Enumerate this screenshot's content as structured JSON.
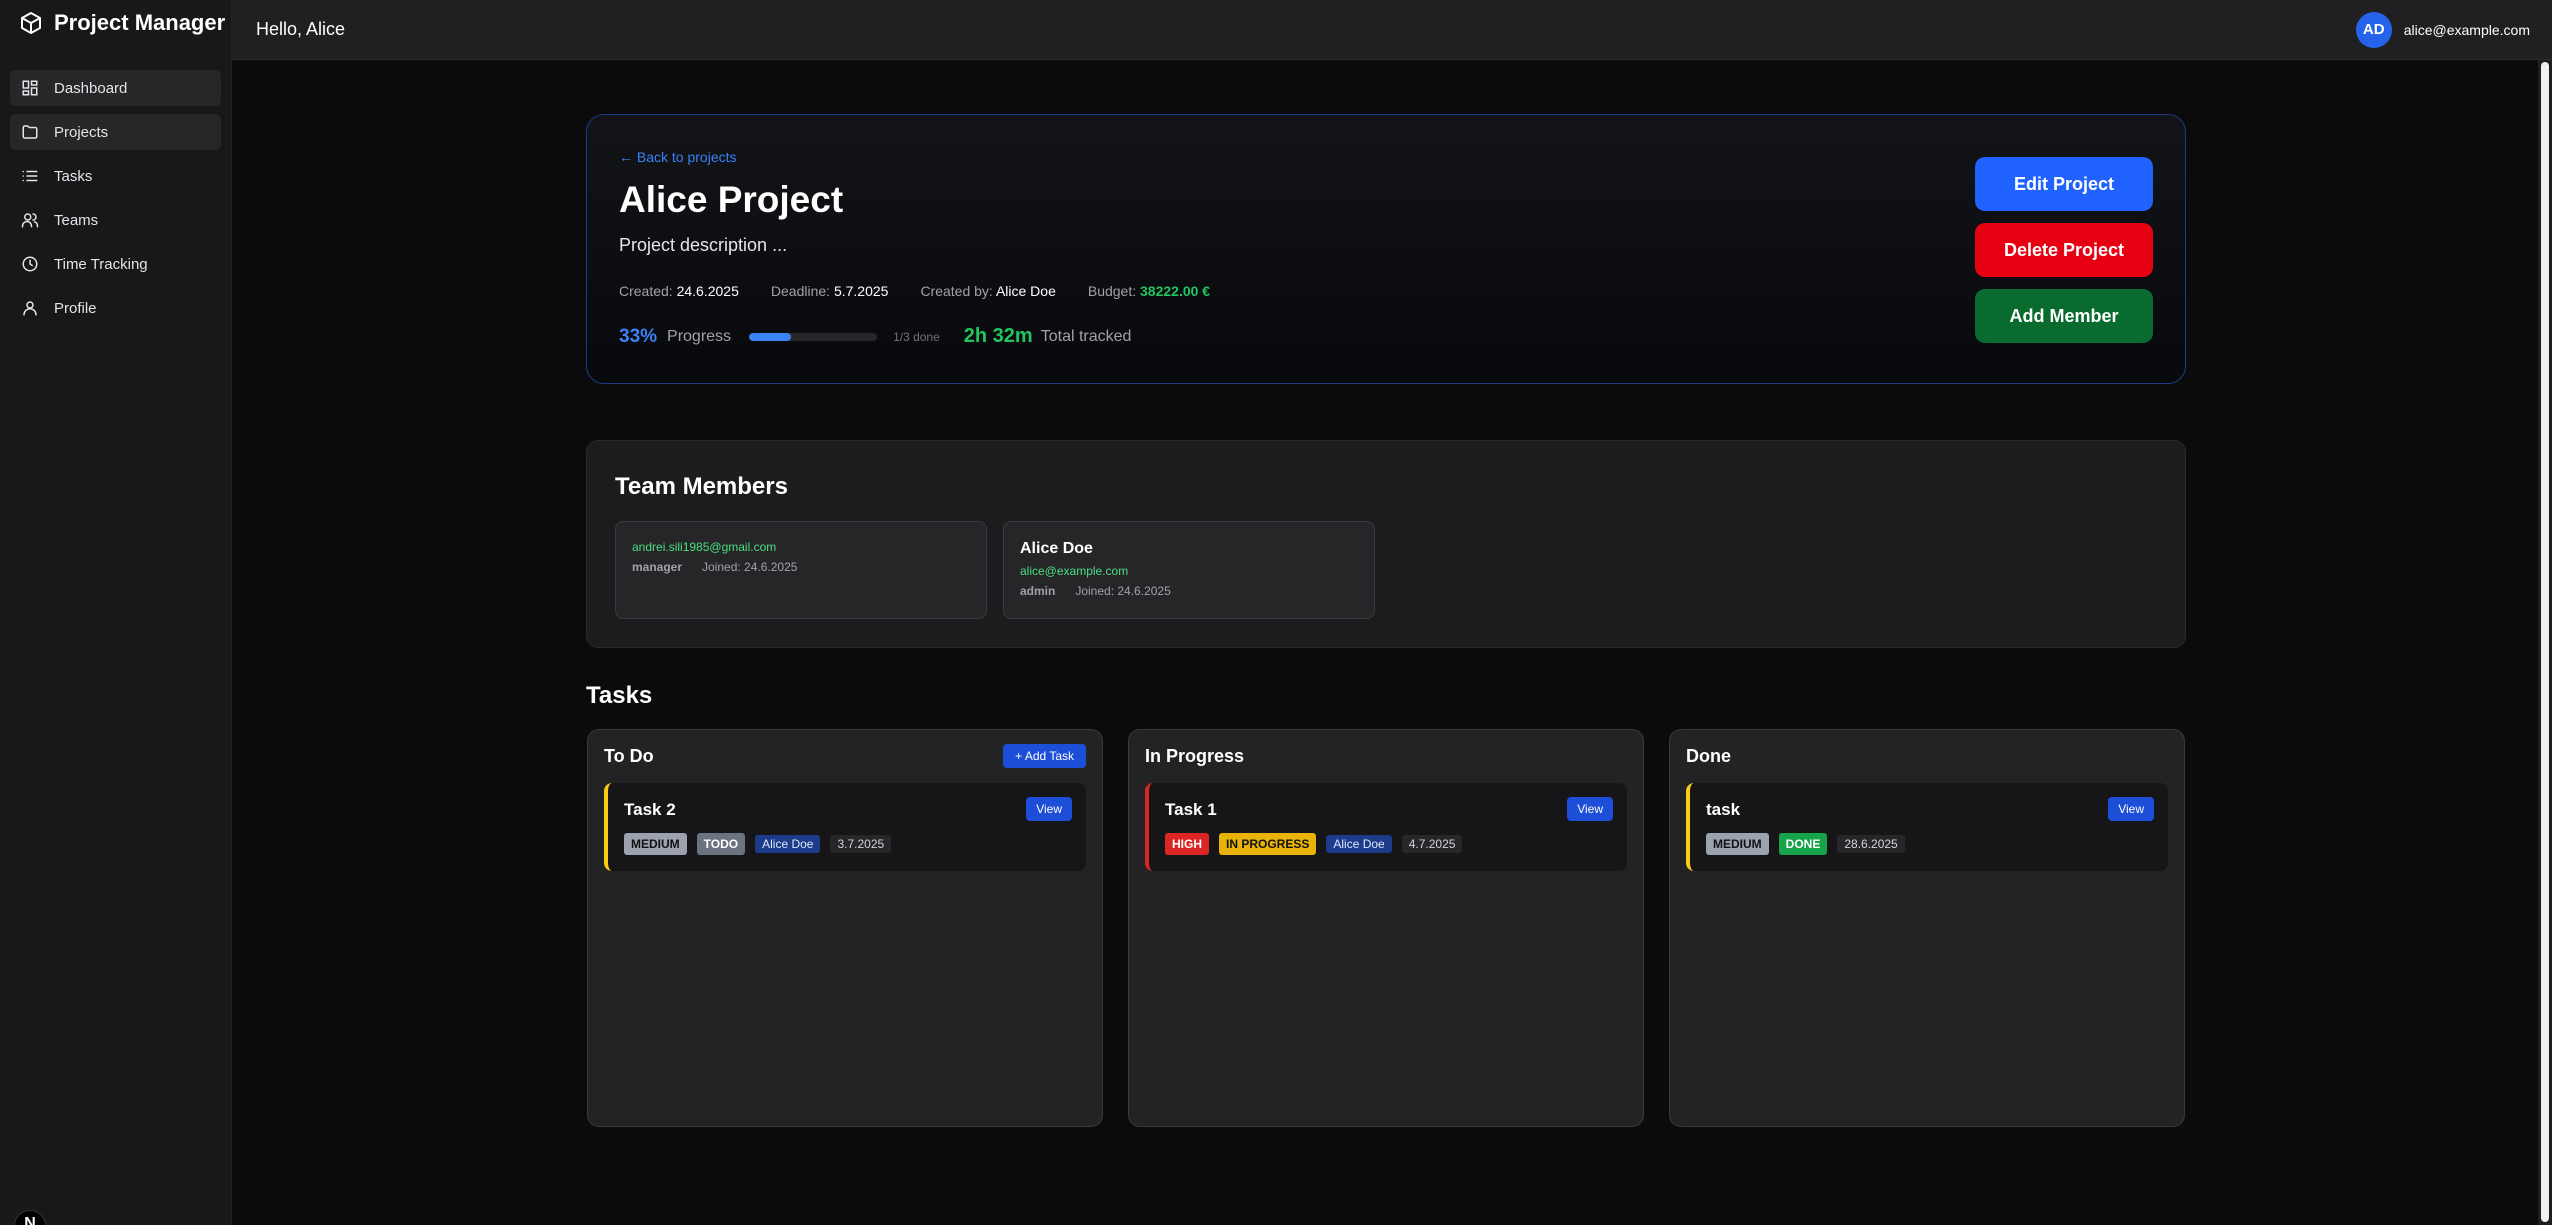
{
  "app": {
    "title": "Project Manager",
    "next_badge": "N"
  },
  "sidebar": {
    "items": [
      {
        "label": "Dashboard",
        "icon": "dashboard-icon"
      },
      {
        "label": "Projects",
        "icon": "folder-icon"
      },
      {
        "label": "Tasks",
        "icon": "list-icon"
      },
      {
        "label": "Teams",
        "icon": "users-icon"
      },
      {
        "label": "Time Tracking",
        "icon": "clock-icon"
      },
      {
        "label": "Profile",
        "icon": "user-icon"
      }
    ]
  },
  "header": {
    "greeting": "Hello, Alice",
    "avatar_initials": "AD",
    "email": "alice@example.com"
  },
  "project": {
    "back_link": "← Back to projects",
    "title": "Alice Project",
    "description": "Project description ...",
    "created_label": "Created:",
    "created": "24.6.2025",
    "deadline_label": "Deadline:",
    "deadline": "5.7.2025",
    "created_by_label": "Created by:",
    "created_by": "Alice Doe",
    "budget_label": "Budget:",
    "budget": "38222.00 €",
    "progress_pct": "33%",
    "progress_label": "Progress",
    "progress_fraction": 0.33,
    "done_count": "1/3 done",
    "tracked_time": "2h 32m",
    "tracked_label": "Total tracked",
    "buttons": {
      "edit": "Edit Project",
      "delete": "Delete Project",
      "add_member": "Add Member"
    }
  },
  "team": {
    "title": "Team Members",
    "members": [
      {
        "name": "",
        "email": "andrei.sili1985@gmail.com",
        "role": "manager",
        "joined": "Joined: 24.6.2025"
      },
      {
        "name": "Alice Doe",
        "email": "alice@example.com",
        "role": "admin",
        "joined": "Joined: 24.6.2025"
      }
    ]
  },
  "tasks": {
    "title": "Tasks",
    "add_task": "+ Add Task",
    "view_label": "View",
    "columns": [
      {
        "title": "To Do",
        "task": {
          "name": "Task 2",
          "priority": "MEDIUM",
          "status": "TODO",
          "assignee": "Alice Doe",
          "date": "3.7.2025"
        }
      },
      {
        "title": "In Progress",
        "task": {
          "name": "Task 1",
          "priority": "HIGH",
          "status": "IN PROGRESS",
          "assignee": "Alice Doe",
          "date": "4.7.2025"
        }
      },
      {
        "title": "Done",
        "task": {
          "name": "task",
          "priority": "MEDIUM",
          "status": "DONE",
          "assignee": "",
          "date": "28.6.2025"
        }
      }
    ]
  },
  "colors": {
    "accent": "#1f62ff",
    "danger": "#e60012",
    "success": "#0a6b2e",
    "border_blue": "#1e3a8a"
  }
}
